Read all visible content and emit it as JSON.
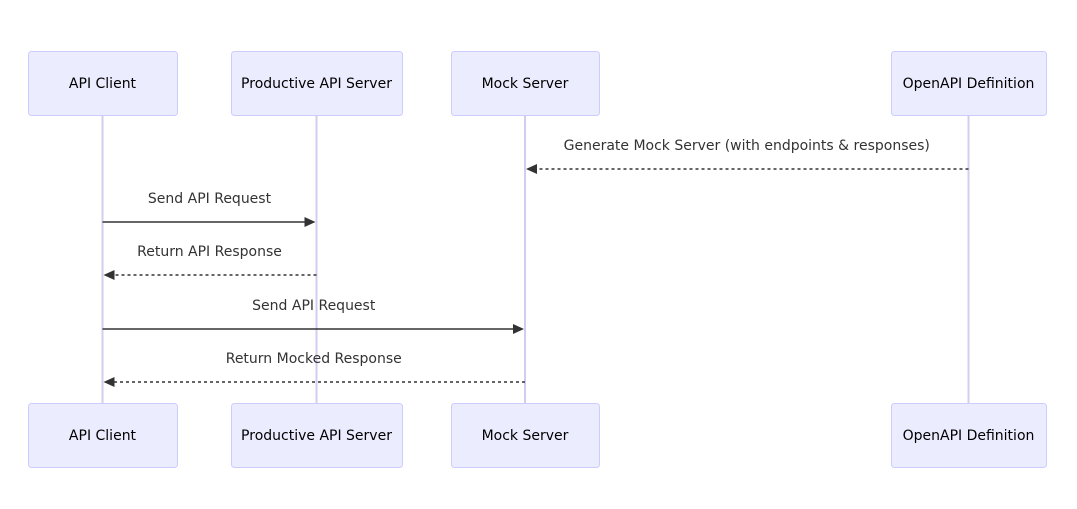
{
  "diagram": {
    "type": "sequence",
    "colors": {
      "actor_fill": "#ECECFF",
      "actor_border": "#CCCCFF",
      "lifeline": "#D4CCF0",
      "arrow": "#333333"
    },
    "actors": [
      {
        "id": "client",
        "label": "API Client"
      },
      {
        "id": "prod",
        "label": "Productive API Server"
      },
      {
        "id": "mock",
        "label": "Mock Server"
      },
      {
        "id": "openapi",
        "label": "OpenAPI Definition"
      }
    ],
    "messages": [
      {
        "from": "openapi",
        "to": "mock",
        "label": "Generate Mock Server (with endpoints & responses)",
        "style": "dashed"
      },
      {
        "from": "client",
        "to": "prod",
        "label": "Send API Request",
        "style": "solid"
      },
      {
        "from": "prod",
        "to": "client",
        "label": "Return API Response",
        "style": "dashed"
      },
      {
        "from": "client",
        "to": "mock",
        "label": "Send API Request",
        "style": "solid"
      },
      {
        "from": "mock",
        "to": "client",
        "label": "Return Mocked Response",
        "style": "dashed"
      }
    ]
  }
}
